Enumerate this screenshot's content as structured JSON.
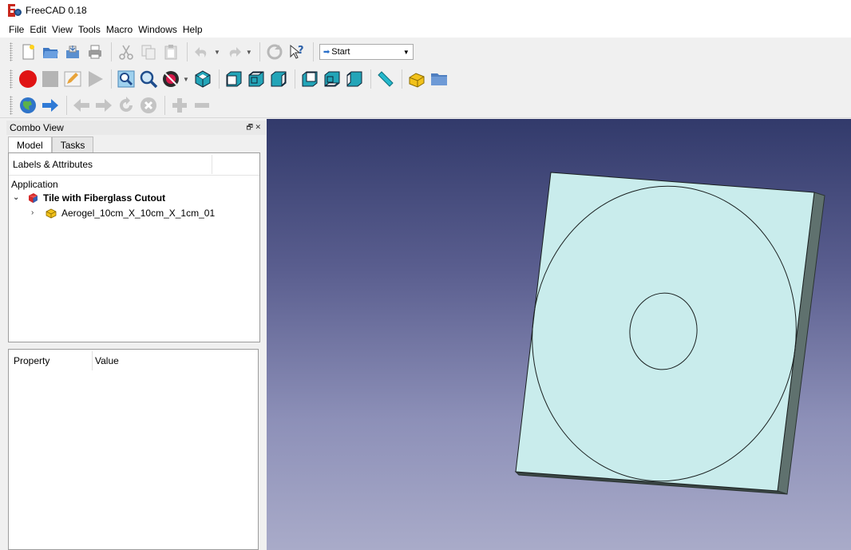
{
  "window": {
    "title": "FreeCAD 0.18"
  },
  "menu": [
    "File",
    "Edit",
    "View",
    "Tools",
    "Macro",
    "Windows",
    "Help"
  ],
  "toolbar": {
    "workbench": "Start",
    "row1_icons": [
      "new-file-icon",
      "open-file-icon",
      "save-icon",
      "print-icon",
      "cut-icon",
      "copy-icon",
      "paste-icon",
      "undo-icon",
      "redo-icon",
      "refresh-icon",
      "whats-this-icon"
    ],
    "row2_icons": [
      "macro-record-icon",
      "macro-stop-icon",
      "macro-edit-icon",
      "macro-run-icon",
      "fit-all-icon",
      "fit-selection-icon",
      "draw-style-icon",
      "isometric-view-icon",
      "front-view-icon",
      "top-view-icon",
      "right-view-icon",
      "rear-view-icon",
      "bottom-view-icon",
      "left-view-icon",
      "measure-distance-icon",
      "part-icon",
      "group-icon"
    ],
    "row3_icons": [
      "web-start-icon",
      "web-go-icon",
      "web-back-icon",
      "web-forward-icon",
      "web-refresh-icon",
      "web-stop-icon",
      "zoom-in-icon",
      "zoom-out-icon"
    ]
  },
  "combo_view": {
    "title": "Combo View",
    "tabs": [
      "Model",
      "Tasks"
    ],
    "tree": {
      "header": "Labels & Attributes",
      "root": "Application",
      "document": "Tile with Fiberglass Cutout",
      "children": [
        "Aerogel_10cm_X_10cm_X_1cm_01"
      ]
    },
    "properties": {
      "col_property": "Property",
      "col_value": "Value"
    }
  },
  "colors": {
    "tile_face": "#c9ecec",
    "tile_side": "#5f716e",
    "bg_top": "#323a6b",
    "bg_bottom": "#a9abc9"
  }
}
